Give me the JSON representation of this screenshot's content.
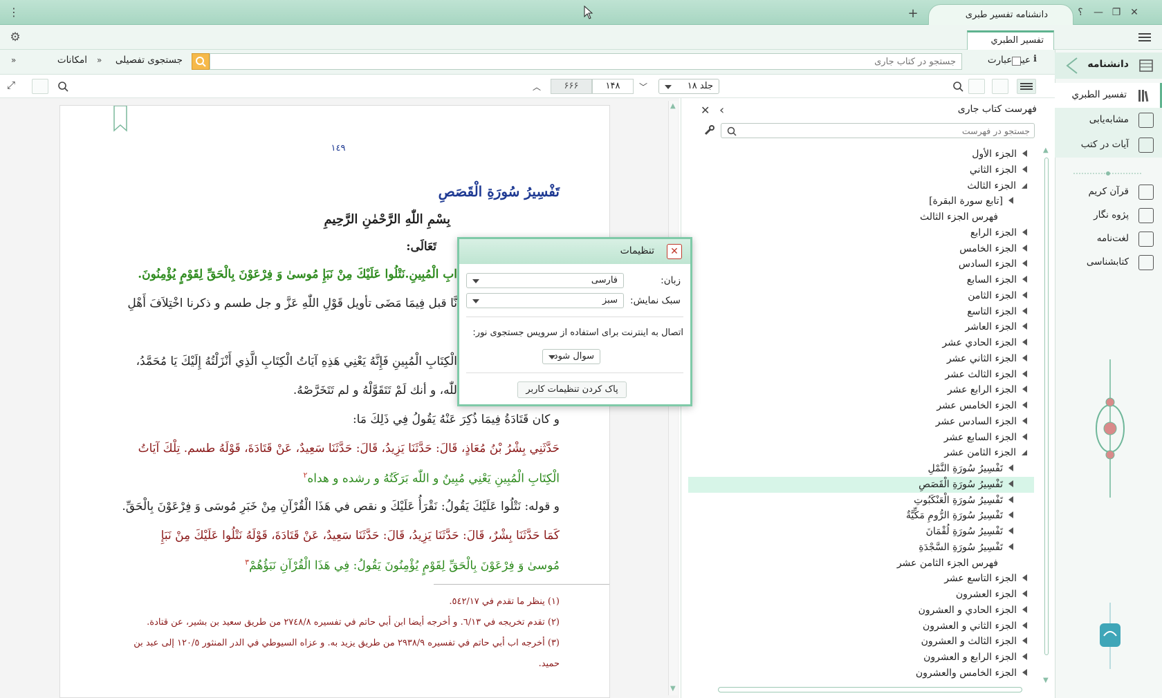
{
  "window": {
    "tab_title": "دانشنامه تفسیر طبری",
    "help_glyph": "؟",
    "new_tab_glyph": "+"
  },
  "book_tab": {
    "label": "تفسير الطبري"
  },
  "nav": {
    "header": "دانشنامه",
    "items": [
      {
        "label": "تفسیر الطبري",
        "icon": "books-icon"
      },
      {
        "label": "مشابه‌یابی",
        "icon": "compare-icon"
      },
      {
        "label": "آیات در کتب",
        "icon": "verses-icon"
      },
      {
        "label": "قرآن کریم",
        "icon": "quran-icon"
      },
      {
        "label": "پژوه نگار",
        "icon": "notebook-icon"
      },
      {
        "label": "لغت‌نامه",
        "icon": "dictionary-icon"
      },
      {
        "label": "کتابشناسی",
        "icon": "info-icon"
      }
    ]
  },
  "search": {
    "exact_label": "عین عبارت",
    "placeholder": "جستجو در کتاب جاری",
    "advanced_label": "جستجوی تفصیلی",
    "options_label": "امکانات"
  },
  "toolbar": {
    "volume": "جلد ۱۸",
    "page": "۱۴۸",
    "total_pages": "۶۶۶"
  },
  "content": {
    "page_number": "١٤٩",
    "title": "تَفْسِيرُ سُورَةِ الْقَصَصِ",
    "basmala": "بِسْمِ اللّٰهِ الرَّحْمٰنِ الرَّحِيمِ",
    "l1": "تَعَالَى:",
    "l2": "ابِ الْمُبِينِ.نَتْلُوا عَلَيْكَ مِنْ نَبَإِ مُوسىٰ وَ فِرْعَوْنَ بِالْحَقِّ لِقَوْمٍ يُؤْمِنُونَ.",
    "l3": "نَّا قبل فِيمَا مَضَى تأويل قَوْلِ اللّٰهِ عَزَّ و جل طسم و ذكرنا اخْتِلاَفَ أَهْلِ",
    "l4": "الْكِتَابِ الْمُبِينِ فَإِنَّهُ يَعْنِي هَذِهِ آيَاتُ الْكِتَابِ الَّذِي أَنْزَلْتُهُ إِلَيْكَ يَا مُحَمَّدُ،",
    "l5": "للّٰه، و أنك لَمْ تَتَقَوَّلْهُ و لم تَتَخَرَّصْهُ.",
    "l6": "و كان قَتَادَةُ فِيمَا ذُكِرَ عَنْهُ يَقُولُ فِي ذَلِكَ مَا:",
    "l7": "حَدَّثَنِي بِشْرُ بْنُ مُعَاذٍ، قَالَ: حَدَّثَنَا يَزِيدُ، قَالَ: حَدَّثَنَا سَعِيدٌ، عَنْ قَتَادَةَ، قَوْلَهُ طسم. تِلْكَ آيَاتُ",
    "l8": "الْكِتَابِ الْمُبِينِ يَعْنِي مُبِينٌ و اللّٰه بَرَكَتُهُ و رشده و هداه",
    "l8_note": "٢",
    "l9": "و قوله: نَتْلُوا عَلَيْكَ يَقُولُ: نَقْرَأُ عَلَيْكَ و نقص في هَذَا الْقُرْآنِ مِنْ خَبَرِ مُوسَى وَ فِرْعَوْنَ بِالْحَقِّ.",
    "l10": "كَمَا حَدَّثَنَا بِشْرٌ، قَالَ: حَدَّثَنَا يَزِيدُ، قَالَ: حَدَّثَنَا سَعِيدٌ، عَنْ قَتَادَةَ، قَوْلَهُ نَتْلُوا عَلَيْكَ مِنْ نَبَإِ",
    "l11": "مُوسىٰ وَ فِرْعَوْنَ بِالْحَقِّ لِقَوْمٍ يُؤْمِنُونَ يَقُولُ: فِي هَذَا الْقُرْآنِ نَبَؤُهُمْ",
    "l11_note": "٣",
    "footnotes": [
      "(١)  ينظر ما تقدم في ٥٤٢/١٧.",
      "(٢)  تقدم تخريجه في ٦/١٣. و أخرجه أيضا ابن أبي حاتم في تفسيره ٢٧٤٨/٨ من طريق سعيد بن بشير، عن قتادة.",
      "(٣)  أخرجه اب أبي حاتم في تفسيره ٢٩٣٨/٩ من طريق يزيد به. و عزاه السيوطي في الدر المنثور ١٢٠/٥ إلى عبد بن",
      "حميد."
    ]
  },
  "toc": {
    "title": "فهرست کتاب جاری",
    "search_placeholder": "جستجو در فهرست",
    "rows": [
      {
        "label": "الجزء الأول",
        "level": 0,
        "arrow": "closed"
      },
      {
        "label": "الجزء الثاني",
        "level": 0,
        "arrow": "closed"
      },
      {
        "label": "الجزء الثالث",
        "level": 0,
        "arrow": "open"
      },
      {
        "label": "[تابع سورة البقرة]",
        "level": 1,
        "arrow": "closed"
      },
      {
        "label": "فهرس الجزء الثالث",
        "level": 1,
        "arrow": "none"
      },
      {
        "label": "الجزء الرابع",
        "level": 0,
        "arrow": "closed"
      },
      {
        "label": "الجزء الخامس",
        "level": 0,
        "arrow": "closed"
      },
      {
        "label": "الجزء السادس",
        "level": 0,
        "arrow": "closed"
      },
      {
        "label": "الجزء السابع",
        "level": 0,
        "arrow": "closed"
      },
      {
        "label": "الجزء الثامن",
        "level": 0,
        "arrow": "closed"
      },
      {
        "label": "الجزء التاسع",
        "level": 0,
        "arrow": "closed"
      },
      {
        "label": "الجزء العاشر",
        "level": 0,
        "arrow": "closed"
      },
      {
        "label": "الجزء الحادي عشر",
        "level": 0,
        "arrow": "closed"
      },
      {
        "label": "الجزء الثاني عشر",
        "level": 0,
        "arrow": "closed"
      },
      {
        "label": "الجزء الثالث عشر",
        "level": 0,
        "arrow": "closed"
      },
      {
        "label": "الجزء الرابع عشر",
        "level": 0,
        "arrow": "closed"
      },
      {
        "label": "الجزء الخامس عشر",
        "level": 0,
        "arrow": "closed"
      },
      {
        "label": "الجزء السادس عشر",
        "level": 0,
        "arrow": "closed"
      },
      {
        "label": "الجزء السابع عشر",
        "level": 0,
        "arrow": "closed"
      },
      {
        "label": "الجزء الثامن عشر",
        "level": 0,
        "arrow": "open"
      },
      {
        "label": "تَفْسِيرُ سُورَةِ النَّمْلِ",
        "level": 1,
        "arrow": "closed"
      },
      {
        "label": "تَفْسِيرُ سُورَةِ الْقَصَصِ",
        "level": 1,
        "arrow": "closed",
        "selected": true
      },
      {
        "label": "تَفْسِيرُ سُورَةِ الْعَنْكَبُوتِ",
        "level": 1,
        "arrow": "closed"
      },
      {
        "label": "تَفْسِيرُ سُورَةِ الرُّومِ مَكِّيَّةٌ",
        "level": 1,
        "arrow": "closed"
      },
      {
        "label": "تَفْسِيرُ سُورَةِ لُقْمَانَ",
        "level": 1,
        "arrow": "closed"
      },
      {
        "label": "تَفْسِيرُ سُورَةِ السَّجْدَةِ",
        "level": 1,
        "arrow": "closed"
      },
      {
        "label": "فهرس الجزء الثامن عشر",
        "level": 1,
        "arrow": "none"
      },
      {
        "label": "الجزء التاسع عشر",
        "level": 0,
        "arrow": "closed"
      },
      {
        "label": "الجزء العشرون",
        "level": 0,
        "arrow": "closed"
      },
      {
        "label": "الجزء الحادي و العشرون",
        "level": 0,
        "arrow": "closed"
      },
      {
        "label": "الجزء الثاني و العشرون",
        "level": 0,
        "arrow": "closed"
      },
      {
        "label": "الجزء الثالث و العشرون",
        "level": 0,
        "arrow": "closed"
      },
      {
        "label": "الجزء الرابع و العشرون",
        "level": 0,
        "arrow": "closed"
      },
      {
        "label": "الجزء الخامس والعشرون",
        "level": 0,
        "arrow": "closed"
      }
    ]
  },
  "dialog": {
    "title": "تنظیمات",
    "language_label": "زبان:",
    "language_value": "فارسی",
    "theme_label": "سبک نمایش:",
    "theme_value": "سبز",
    "internet_text": "اتصال به اینترنت برای استفاده از سرویس جستجوی نور:",
    "internet_value": "سوال شود",
    "reset_label": "پاک کردن تنظیمات کاربر"
  },
  "colors": {
    "accent": "#5fb38f",
    "quran_green": "#2e8b1e",
    "hadith_red": "#8b1a1a",
    "title_blue": "#1f3a93",
    "selected_row": "#d7f5e8"
  }
}
